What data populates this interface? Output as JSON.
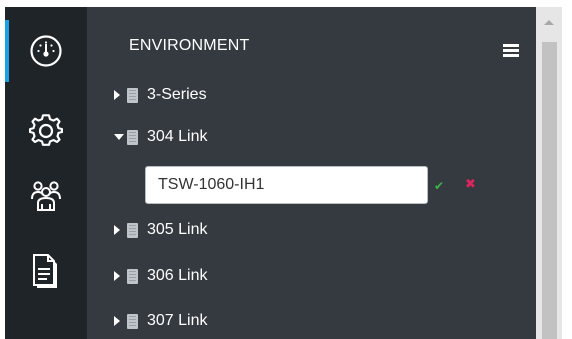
{
  "sidebar": {
    "items": [
      {
        "icon": "dashboard-gauge-icon",
        "active": true
      },
      {
        "icon": "gear-icon",
        "active": false
      },
      {
        "icon": "users-group-icon",
        "active": false
      },
      {
        "icon": "document-icon",
        "active": false
      }
    ],
    "active_color": "#1aa0e6"
  },
  "panel": {
    "title": "ENVIRONMENT",
    "menu_icon": "hamburger-menu-icon"
  },
  "tree": {
    "items": [
      {
        "label": "3-Series",
        "expanded": false
      },
      {
        "label": "304 Link",
        "expanded": true
      },
      {
        "label": "305 Link",
        "expanded": false
      },
      {
        "label": "306 Link",
        "expanded": false
      },
      {
        "label": "307 Link",
        "expanded": false
      }
    ],
    "edit": {
      "value": "TSW-1060-IH1",
      "confirm_icon": "checkmark-icon",
      "confirm_glyph": "✔",
      "cancel_icon": "close-icon",
      "cancel_glyph": "✖"
    }
  },
  "colors": {
    "sidebar_bg": "#1f2429",
    "panel_bg": "#343a40",
    "confirm": "#3cb44a",
    "cancel": "#e0245e"
  }
}
